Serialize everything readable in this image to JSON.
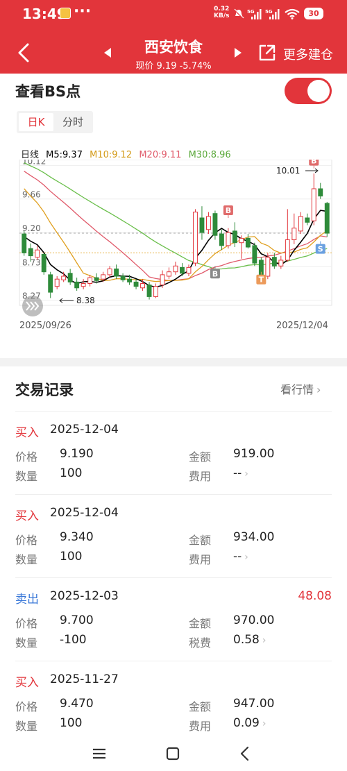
{
  "status_bar": {
    "time": "13:49",
    "dots": "···",
    "net_speed": "0.32",
    "net_unit": "KB/s",
    "battery": "30"
  },
  "header": {
    "stock_name": "西安饮食",
    "price_line": "现价 9.19 -5.74%",
    "more_label": "更多建仓"
  },
  "bs": {
    "title": "查看BS点",
    "toggle_on": true,
    "tabs": [
      "日K",
      "分时"
    ],
    "ma": {
      "label": "日线",
      "m5": "M5:9.37",
      "m10": "M10:9.12",
      "m20": "M20:9.11",
      "m30": "M30:8.96"
    },
    "ma_colors": {
      "m5": "#000000",
      "m10": "#e0a020",
      "m20": "#e05a6a",
      "m30": "#6abf4b"
    },
    "date_start": "2025/09/26",
    "date_end": "2025/12/04"
  },
  "chart_data": {
    "type": "candlestick",
    "y_ticks": [
      "10.12",
      "9.66",
      "9.20",
      "8.73",
      "8.27"
    ],
    "annotations": {
      "high": "10.01",
      "low": "8.38"
    },
    "marker_labels": {
      "buy": "B",
      "sell": "S",
      "t": "T"
    },
    "x_start": "2025/09/26",
    "x_end": "2025/12/04",
    "ylim": [
      8.2,
      10.2
    ],
    "candles": [
      [
        9.18,
        8.92,
        9.22,
        8.88
      ],
      [
        8.98,
        8.88,
        9.05,
        8.8
      ],
      [
        8.86,
        8.96,
        9.02,
        8.82
      ],
      [
        8.9,
        8.66,
        8.92,
        8.62
      ],
      [
        8.62,
        8.38,
        8.66,
        8.3
      ],
      [
        8.46,
        8.56,
        8.6,
        8.42
      ],
      [
        8.55,
        8.6,
        8.66,
        8.52
      ],
      [
        8.64,
        8.52,
        8.7,
        8.48
      ],
      [
        8.52,
        8.44,
        8.58,
        8.4
      ],
      [
        8.46,
        8.5,
        8.56,
        8.42
      ],
      [
        8.5,
        8.58,
        8.62,
        8.46
      ],
      [
        8.58,
        8.54,
        8.64,
        8.5
      ],
      [
        8.56,
        8.62,
        8.66,
        8.52
      ],
      [
        8.62,
        8.7,
        8.74,
        8.58
      ],
      [
        8.7,
        8.6,
        8.76,
        8.56
      ],
      [
        8.6,
        8.55,
        8.64,
        8.52
      ],
      [
        8.56,
        8.52,
        8.62,
        8.48
      ],
      [
        8.52,
        8.46,
        8.56,
        8.42
      ],
      [
        8.44,
        8.5,
        8.56,
        8.4
      ],
      [
        8.48,
        8.32,
        8.52,
        8.28
      ],
      [
        8.32,
        8.46,
        8.5,
        8.3
      ],
      [
        8.48,
        8.62,
        8.68,
        8.44
      ],
      [
        8.6,
        8.66,
        8.72,
        8.56
      ],
      [
        8.66,
        8.74,
        8.8,
        8.62
      ],
      [
        8.72,
        8.64,
        8.78,
        8.6
      ],
      [
        8.64,
        8.72,
        8.76,
        8.6
      ],
      [
        8.78,
        9.48,
        9.52,
        8.74
      ],
      [
        9.4,
        9.2,
        9.56,
        9.1
      ],
      [
        9.24,
        9.42,
        9.48,
        9.18
      ],
      [
        9.46,
        9.16,
        9.5,
        9.1
      ],
      [
        9.18,
        9.02,
        9.24,
        8.96
      ],
      [
        9.02,
        9.2,
        9.26,
        8.98
      ],
      [
        9.22,
        9.06,
        9.34,
        9.0
      ],
      [
        9.06,
        9.12,
        9.16,
        8.84
      ],
      [
        9.12,
        9.0,
        9.18,
        8.98
      ],
      [
        9.02,
        8.78,
        9.06,
        8.74
      ],
      [
        8.82,
        8.58,
        8.86,
        8.54
      ],
      [
        8.6,
        8.86,
        8.92,
        8.56
      ],
      [
        8.86,
        8.74,
        8.92,
        8.7
      ],
      [
        8.74,
        8.82,
        8.88,
        8.7
      ],
      [
        8.82,
        9.1,
        9.52,
        8.8
      ],
      [
        9.1,
        9.26,
        9.46,
        9.04
      ],
      [
        9.22,
        9.42,
        9.48,
        9.18
      ],
      [
        9.4,
        9.34,
        9.46,
        9.3
      ],
      [
        9.36,
        9.8,
        10.01,
        9.3
      ],
      [
        9.8,
        9.7,
        9.88,
        9.66
      ],
      [
        9.6,
        9.19,
        9.62,
        9.14
      ]
    ],
    "markers": [
      {
        "index": 31,
        "price": 9.4,
        "type": "buy",
        "pos": "above"
      },
      {
        "index": 29,
        "price": 8.74,
        "type": "buy",
        "pos": "below"
      },
      {
        "index": 36,
        "price": 8.66,
        "type": "t",
        "pos": "below"
      },
      {
        "index": 44,
        "price": 10.08,
        "type": "buy",
        "pos": "above"
      },
      {
        "index": 45,
        "price": 9.08,
        "type": "sell",
        "pos": "below"
      }
    ]
  },
  "trades": {
    "title": "交易记录",
    "view_quote": "看行情",
    "price_label": "价格",
    "qty_label": "数量",
    "amount_label": "金额",
    "items": [
      {
        "type": "买入",
        "side": "buy",
        "date": "2025-12-04",
        "price": "9.190",
        "qty": "100",
        "amount": "919.00",
        "fee_label": "费用",
        "fee": "--",
        "profit": ""
      },
      {
        "type": "买入",
        "side": "buy",
        "date": "2025-12-04",
        "price": "9.340",
        "qty": "100",
        "amount": "934.00",
        "fee_label": "费用",
        "fee": "--",
        "profit": ""
      },
      {
        "type": "卖出",
        "side": "sell",
        "date": "2025-12-03",
        "price": "9.700",
        "qty": "-100",
        "amount": "970.00",
        "fee_label": "税费",
        "fee": "0.58",
        "profit": "48.08"
      },
      {
        "type": "买入",
        "side": "buy",
        "date": "2025-11-27",
        "price": "9.470",
        "qty": "100",
        "amount": "947.00",
        "fee_label": "费用",
        "fee": "0.09",
        "profit": ""
      }
    ]
  }
}
